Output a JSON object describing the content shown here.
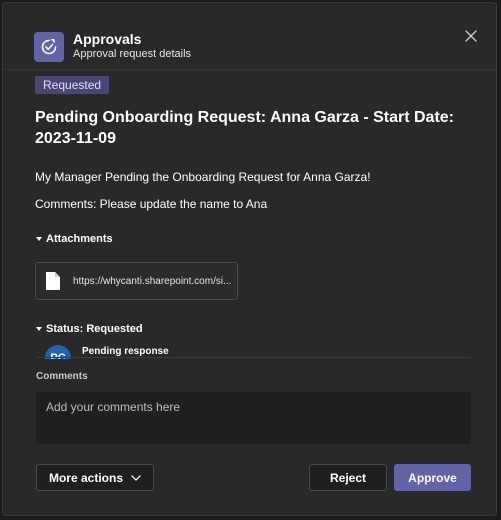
{
  "header": {
    "app_name": "Approvals",
    "subtitle": "Approval request details",
    "app_icon": "approvals-icon",
    "close_icon": "close-icon"
  },
  "request": {
    "status_badge": "Requested",
    "title": "Pending Onboarding Request: Anna Garza - Start Date: 2023-11-09",
    "message": "My Manager Pending the Onboarding Request for Anna Garza!",
    "comments_line": "Comments: Please update the name to Ana"
  },
  "attachments": {
    "heading": "Attachments",
    "items": [
      {
        "label": "https://whycanti.sharepoint.com/si...",
        "icon": "file-icon"
      }
    ]
  },
  "status_section": {
    "heading": "Status: Requested",
    "approvers": [
      {
        "initials": "PC",
        "status": "Pending response"
      }
    ]
  },
  "comments": {
    "label": "Comments",
    "placeholder": "Add your comments here",
    "value": ""
  },
  "actions": {
    "more_actions": "More actions",
    "reject": "Reject",
    "approve": "Approve"
  },
  "colors": {
    "accent": "#6264a7",
    "badge_bg": "#464775",
    "dialog_bg": "#292929",
    "avatar_bg": "#2563a8"
  }
}
